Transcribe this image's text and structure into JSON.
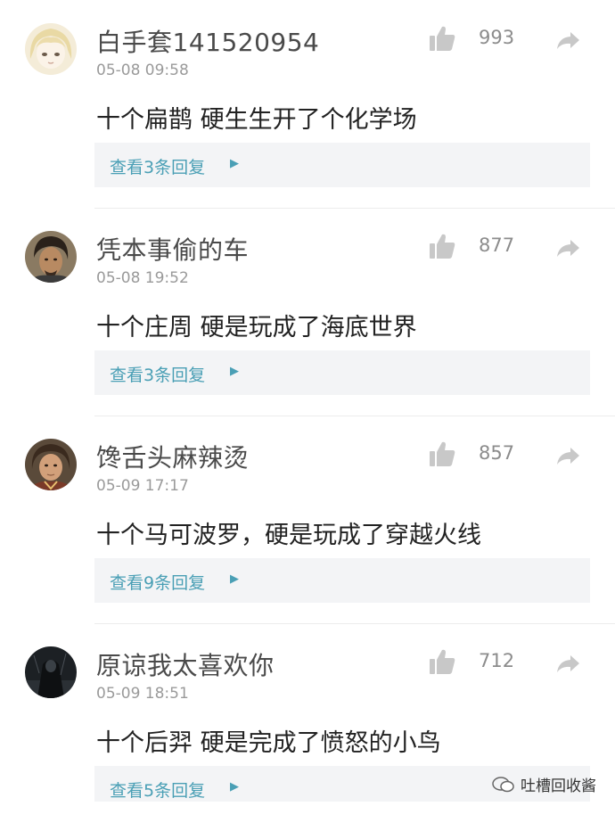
{
  "comments": [
    {
      "username": "白手套141520954",
      "time": "05-08 09:58",
      "likes": "993",
      "text": "十个扁鹊 硬生生开了个化学场",
      "replies": "查看3条回复",
      "avatar": "anime-avatar"
    },
    {
      "username": "凭本事偷的车",
      "time": "05-08 19:52",
      "likes": "877",
      "text": "十个庄周 硬是玩成了海底世界",
      "replies": "查看3条回复",
      "avatar": "man-portrait-avatar"
    },
    {
      "username": "馋舌头麻辣烫",
      "time": "05-09 17:17",
      "likes": "857",
      "text": "十个马可波罗，硬是玩成了穿越火线",
      "replies": "查看9条回复",
      "avatar": "game-character-avatar"
    },
    {
      "username": "原谅我太喜欢你",
      "time": "05-09 18:51",
      "likes": "712",
      "text": "十个后羿 硬是完成了愤怒的小鸟",
      "replies": "查看5条回复",
      "avatar": "dark-figure-avatar"
    }
  ],
  "watermark": {
    "text": "吐槽回收酱"
  },
  "icons": {
    "like": "thumbs-up-icon",
    "share": "share-arrow-icon",
    "more": "chevron-right-icon"
  },
  "colors": {
    "link": "#4a9fb5",
    "reply_bg": "#f3f4f6",
    "icon": "#c8c8c8"
  }
}
